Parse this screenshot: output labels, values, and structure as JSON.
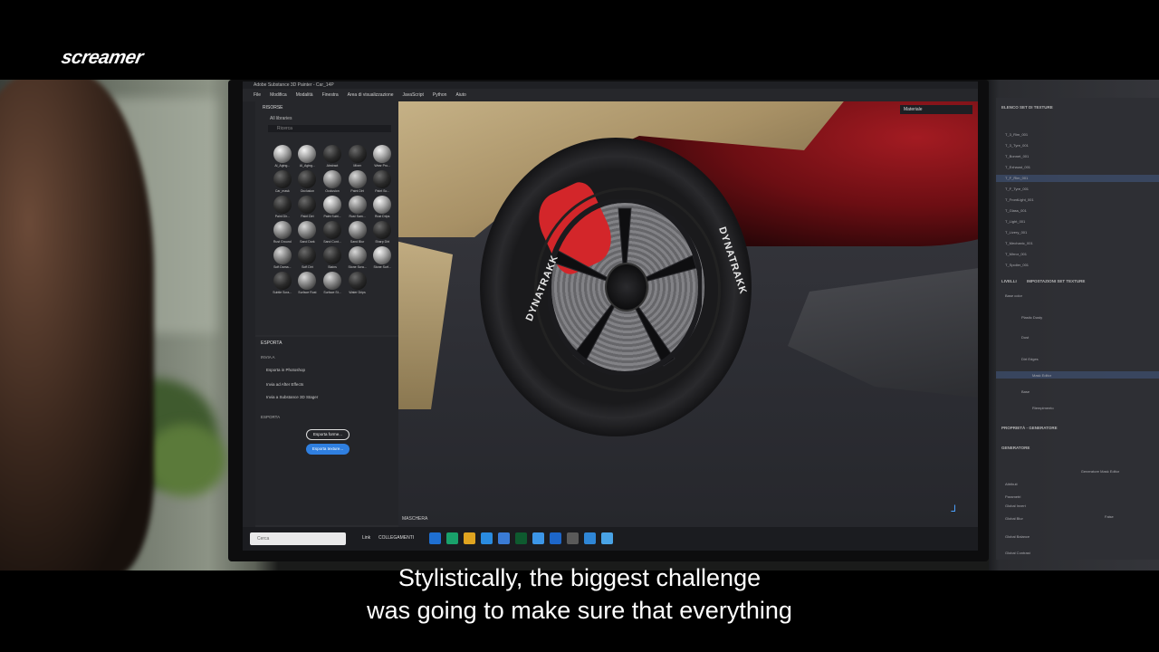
{
  "overlay": {
    "logo": "screamer",
    "subtitle_line1": "Stylistically, the biggest challenge",
    "subtitle_line2": "was going to make sure that everything"
  },
  "app": {
    "title": "Adobe Substance 3D Painter - Car_14P",
    "menu": [
      "File",
      "Modifica",
      "Modalità",
      "Finestra",
      "Area di visualizzazione",
      "JavaScript",
      "Python",
      "Aiuto"
    ]
  },
  "shelf": {
    "title": "RISORSE",
    "subtitle": "All libraries",
    "search_placeholder": "Ricerca",
    "materials": [
      {
        "label": "Al_Aging...",
        "tone": "light"
      },
      {
        "label": "Al_Aging...",
        "tone": "light"
      },
      {
        "label": "Abstract",
        "tone": "dark"
      },
      {
        "label": "Mixer",
        "tone": "dark"
      },
      {
        "label": "Wear Pro...",
        "tone": "light"
      },
      {
        "label": "Car_mask",
        "tone": "dark"
      },
      {
        "label": "Occlusion",
        "tone": "dark"
      },
      {
        "label": "Occlusion",
        "tone": "mid"
      },
      {
        "label": "Paint Dirt",
        "tone": "mid"
      },
      {
        "label": "Paint Sc...",
        "tone": "dark"
      },
      {
        "label": "Paint Dir...",
        "tone": "dark"
      },
      {
        "label": "Paint Dirt",
        "tone": "dark"
      },
      {
        "label": "Paint Subt...",
        "tone": "light"
      },
      {
        "label": "Rust Sam...",
        "tone": "mid"
      },
      {
        "label": "Rust Drips",
        "tone": "light"
      },
      {
        "label": "Rust Ground",
        "tone": "mid"
      },
      {
        "label": "Sand Dark",
        "tone": "mid"
      },
      {
        "label": "Sand Cont...",
        "tone": "dark"
      },
      {
        "label": "Sand Blur",
        "tone": "mid"
      },
      {
        "label": "Sharp Dirt",
        "tone": "dark"
      },
      {
        "label": "Soft Dama...",
        "tone": "mid"
      },
      {
        "label": "Soft Dirt",
        "tone": "dark"
      },
      {
        "label": "Stains",
        "tone": "dark"
      },
      {
        "label": "Stone Scra...",
        "tone": "mid"
      },
      {
        "label": "Stone Surf...",
        "tone": "light"
      },
      {
        "label": "Subtle Scra...",
        "tone": "dark"
      },
      {
        "label": "Surface Rust",
        "tone": "mid"
      },
      {
        "label": "Surface St...",
        "tone": "mid"
      },
      {
        "label": "Water Drips",
        "tone": "dark"
      },
      {
        "label": "",
        "tone": "none"
      }
    ]
  },
  "export_panel": {
    "title": "ESPORTA",
    "section1": "INVIA A",
    "items": [
      "Esporta in Photoshop",
      "Invia ad After Effects",
      "Invia a Substance 3D Stager"
    ],
    "section2": "ESPORTA",
    "button_outline": "Esporta forme...",
    "button_primary": "Esporta texture..."
  },
  "viewport": {
    "dropdown": "Materiale",
    "tire_text": "DYNATRAKK",
    "mask_label": "MASCHERA"
  },
  "taskbar": {
    "search_placeholder": "Cerca",
    "label_link": "Link",
    "label_connections": "COLLEGAMENTI",
    "icon_colors": [
      "#1f6fd1",
      "#19a16b",
      "#e0a420",
      "#2a8be0",
      "#3a7bd5",
      "#0e5a2f",
      "#3c96e8",
      "#1d66c9",
      "#5a5a5a",
      "#2f86d6",
      "#49a3e6"
    ]
  },
  "side_panel": {
    "title_textures": "ELENCO SET DI TEXTURE",
    "textures": [
      "T_3_Rim_001",
      "T_3_Tyre_001",
      "T_Bonnet_001",
      "T_Exhaust_001",
      "T_F_Rim_001",
      "T_F_Tyre_001",
      "T_FrontLight_001",
      "T_Glass_001",
      "T_Light_001",
      "T_Livery_001",
      "T_Mechanic_001",
      "T_Mirror_001",
      "T_Spoiler_001"
    ],
    "title_layers": "LIVELLI",
    "title_settings": "IMPOSTAZIONI SET TEXTURE",
    "base_color": "Base color",
    "layers": [
      "Plastic Dusty",
      "Dust",
      "Dirt Edges",
      "Mask Editor",
      "Base",
      "Riempimento"
    ],
    "title_properties": "PROPRIETÀ - GENERATORE",
    "generator": "GENERATORE",
    "generator_value": "Generatore Mask Editor",
    "attributes": "Attributi",
    "parameters": "Parametri",
    "params": [
      "Global Invert",
      "Global Blur",
      "Global Balance",
      "Global Contrast"
    ],
    "global_invert_value": "False"
  }
}
